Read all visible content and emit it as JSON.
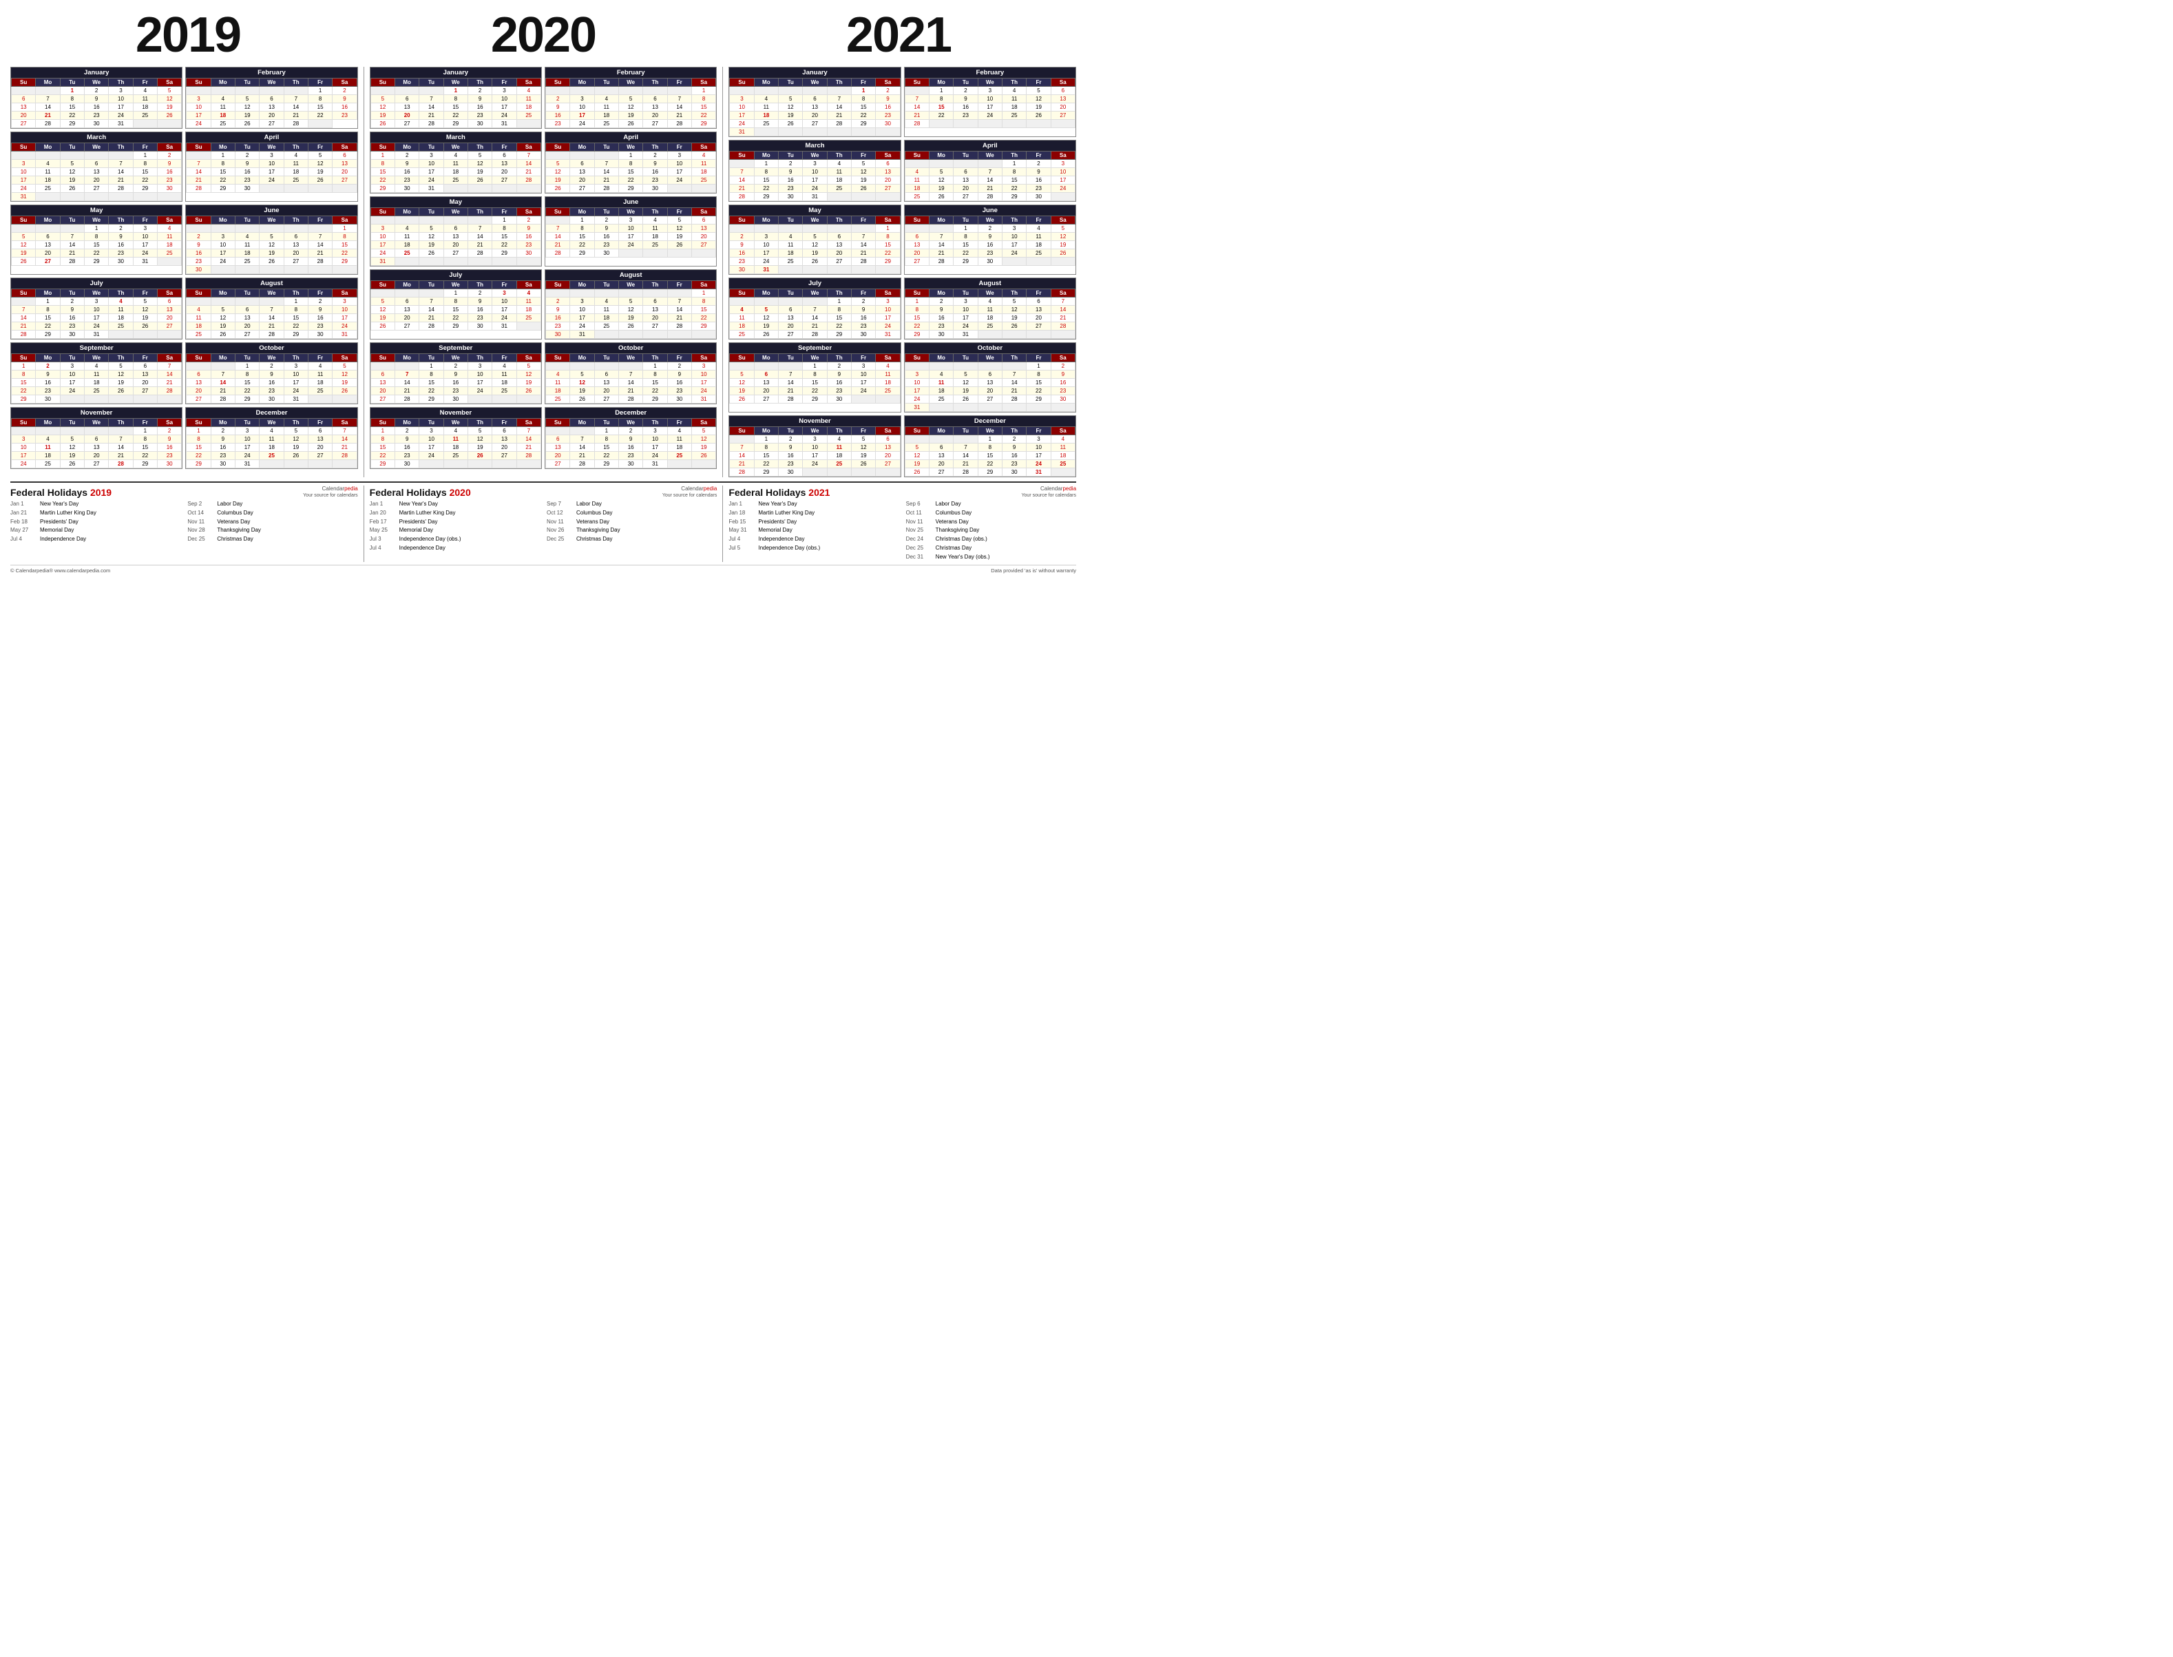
{
  "years": [
    "2019",
    "2020",
    "2021"
  ],
  "months2019": [
    {
      "name": "January",
      "startDay": 2,
      "days": 31,
      "headers": [
        "Su",
        "Mo",
        "Tu",
        "We",
        "Th",
        "Fr",
        "Sa"
      ],
      "rows": [
        [
          "",
          "",
          "1",
          "2",
          "3",
          "4",
          "5"
        ],
        [
          "6",
          "7",
          "8",
          "9",
          "10",
          "11",
          "12"
        ],
        [
          "13",
          "14",
          "15",
          "16",
          "17",
          "18",
          "19"
        ],
        [
          "20",
          "21",
          "22",
          "23",
          "24",
          "25",
          "26"
        ],
        [
          "27",
          "28",
          "29",
          "30",
          "31",
          "",
          ""
        ]
      ],
      "holidays": [
        1,
        21
      ]
    },
    {
      "name": "February",
      "startDay": 5,
      "days": 28,
      "rows": [
        [
          "",
          "",
          "",
          "",
          "",
          "1",
          "2"
        ],
        [
          "3",
          "4",
          "5",
          "6",
          "7",
          "8",
          "9"
        ],
        [
          "10",
          "11",
          "12",
          "13",
          "14",
          "15",
          "16"
        ],
        [
          "17",
          "18",
          "19",
          "20",
          "21",
          "22",
          "23"
        ],
        [
          "24",
          "25",
          "26",
          "27",
          "28",
          "",
          ""
        ]
      ],
      "holidays": [
        18
      ]
    },
    {
      "name": "March",
      "startDay": 5,
      "days": 31,
      "rows": [
        [
          "",
          "",
          "",
          "",
          "",
          "1",
          "2"
        ],
        [
          "3",
          "4",
          "5",
          "6",
          "7",
          "8",
          "9"
        ],
        [
          "10",
          "11",
          "12",
          "13",
          "14",
          "15",
          "16"
        ],
        [
          "17",
          "18",
          "19",
          "20",
          "21",
          "22",
          "23"
        ],
        [
          "24",
          "25",
          "26",
          "27",
          "28",
          "29",
          "30"
        ],
        [
          "31",
          "",
          "",
          "",
          "",
          "",
          ""
        ]
      ]
    },
    {
      "name": "April",
      "startDay": 1,
      "days": 30,
      "rows": [
        [
          "",
          "1",
          "2",
          "3",
          "4",
          "5",
          "6"
        ],
        [
          "7",
          "8",
          "9",
          "10",
          "11",
          "12",
          "13"
        ],
        [
          "14",
          "15",
          "16",
          "17",
          "18",
          "19",
          "20"
        ],
        [
          "21",
          "22",
          "23",
          "24",
          "25",
          "26",
          "27"
        ],
        [
          "28",
          "29",
          "30",
          "",
          "",
          "",
          ""
        ]
      ]
    },
    {
      "name": "May",
      "startDay": 3,
      "days": 31,
      "rows": [
        [
          "",
          "",
          "",
          "1",
          "2",
          "3",
          "4"
        ],
        [
          "5",
          "6",
          "7",
          "8",
          "9",
          "10",
          "11"
        ],
        [
          "12",
          "13",
          "14",
          "15",
          "16",
          "17",
          "18"
        ],
        [
          "19",
          "20",
          "21",
          "22",
          "23",
          "24",
          "25"
        ],
        [
          "26",
          "27",
          "28",
          "29",
          "30",
          "31",
          ""
        ]
      ],
      "holidays": [
        27
      ]
    },
    {
      "name": "June",
      "startDay": 6,
      "days": 30,
      "rows": [
        [
          "",
          "",
          "",
          "",
          "",
          "",
          "1"
        ],
        [
          "2",
          "3",
          "4",
          "5",
          "6",
          "7",
          "8"
        ],
        [
          "9",
          "10",
          "11",
          "12",
          "13",
          "14",
          "15"
        ],
        [
          "16",
          "17",
          "18",
          "19",
          "20",
          "21",
          "22"
        ],
        [
          "23",
          "24",
          "25",
          "26",
          "27",
          "28",
          "29"
        ],
        [
          "30",
          "",
          "",
          "",
          "",
          "",
          ""
        ]
      ]
    },
    {
      "name": "July",
      "startDay": 1,
      "days": 31,
      "rows": [
        [
          "",
          "1",
          "2",
          "3",
          "4",
          "5",
          "6"
        ],
        [
          "7",
          "8",
          "9",
          "10",
          "11",
          "12",
          "13"
        ],
        [
          "14",
          "15",
          "16",
          "17",
          "18",
          "19",
          "20"
        ],
        [
          "21",
          "22",
          "23",
          "24",
          "25",
          "26",
          "27"
        ],
        [
          "28",
          "29",
          "30",
          "31",
          "",
          "",
          ""
        ]
      ],
      "holidays": [
        4
      ]
    },
    {
      "name": "August",
      "startDay": 4,
      "days": 31,
      "rows": [
        [
          "",
          "",
          "",
          "",
          "1",
          "2",
          "3"
        ],
        [
          "4",
          "5",
          "6",
          "7",
          "8",
          "9",
          "10"
        ],
        [
          "11",
          "12",
          "13",
          "14",
          "15",
          "16",
          "17"
        ],
        [
          "18",
          "19",
          "20",
          "21",
          "22",
          "23",
          "24"
        ],
        [
          "25",
          "26",
          "27",
          "28",
          "29",
          "30",
          "31"
        ]
      ]
    },
    {
      "name": "September",
      "startDay": 0,
      "days": 30,
      "rows": [
        [
          "1",
          "2",
          "3",
          "4",
          "5",
          "6",
          "7"
        ],
        [
          "8",
          "9",
          "10",
          "11",
          "12",
          "13",
          "14"
        ],
        [
          "15",
          "16",
          "17",
          "18",
          "19",
          "20",
          "21"
        ],
        [
          "22",
          "23",
          "24",
          "25",
          "26",
          "27",
          "28"
        ],
        [
          "29",
          "30",
          "",
          "",
          "",
          "",
          ""
        ]
      ],
      "holidays": [
        2
      ]
    },
    {
      "name": "October",
      "startDay": 2,
      "days": 31,
      "rows": [
        [
          "",
          "",
          "1",
          "2",
          "3",
          "4",
          "5"
        ],
        [
          "6",
          "7",
          "8",
          "9",
          "10",
          "11",
          "12"
        ],
        [
          "13",
          "14",
          "15",
          "16",
          "17",
          "18",
          "19"
        ],
        [
          "20",
          "21",
          "22",
          "23",
          "24",
          "25",
          "26"
        ],
        [
          "27",
          "28",
          "29",
          "30",
          "31",
          "",
          ""
        ]
      ],
      "holidays": [
        14
      ]
    },
    {
      "name": "November",
      "startDay": 5,
      "days": 30,
      "rows": [
        [
          "",
          "",
          "",
          "",
          "",
          "1",
          "2"
        ],
        [
          "3",
          "4",
          "5",
          "6",
          "7",
          "8",
          "9"
        ],
        [
          "10",
          "11",
          "12",
          "13",
          "14",
          "15",
          "16"
        ],
        [
          "17",
          "18",
          "19",
          "20",
          "21",
          "22",
          "23"
        ],
        [
          "24",
          "25",
          "26",
          "27",
          "28",
          "29",
          "30"
        ]
      ],
      "holidays": [
        11,
        28
      ]
    },
    {
      "name": "December",
      "startDay": 0,
      "days": 31,
      "rows": [
        [
          "1",
          "2",
          "3",
          "4",
          "5",
          "6",
          "7"
        ],
        [
          "8",
          "9",
          "10",
          "11",
          "12",
          "13",
          "14"
        ],
        [
          "15",
          "16",
          "17",
          "18",
          "19",
          "20",
          "21"
        ],
        [
          "22",
          "23",
          "24",
          "25",
          "26",
          "27",
          "28"
        ],
        [
          "29",
          "30",
          "31",
          "",
          "",
          "",
          ""
        ]
      ],
      "holidays": [
        25
      ]
    }
  ],
  "federalHolidays": {
    "2019": {
      "left": [
        {
          "date": "Jan 1",
          "name": "New Year's Day"
        },
        {
          "date": "Jan 21",
          "name": "Martin Luther King Day"
        },
        {
          "date": "Feb 18",
          "name": "Presidents' Day"
        },
        {
          "date": "May 27",
          "name": "Memorial Day"
        },
        {
          "date": "Jul 4",
          "name": "Independence Day"
        }
      ],
      "right": [
        {
          "date": "Sep 2",
          "name": "Labor Day"
        },
        {
          "date": "Oct 14",
          "name": "Columbus Day"
        },
        {
          "date": "Nov 11",
          "name": "Veterans Day"
        },
        {
          "date": "Nov 28",
          "name": "Thanksgiving Day"
        },
        {
          "date": "Dec 25",
          "name": "Christmas Day"
        }
      ]
    },
    "2020": {
      "left": [
        {
          "date": "Jan 1",
          "name": "New Year's Day"
        },
        {
          "date": "Jan 20",
          "name": "Martin Luther King Day"
        },
        {
          "date": "Feb 17",
          "name": "Presidents' Day"
        },
        {
          "date": "May 25",
          "name": "Memorial Day"
        },
        {
          "date": "Jul 3",
          "name": "Independence Day (obs.)"
        },
        {
          "date": "Jul 4",
          "name": "Independence Day"
        }
      ],
      "right": [
        {
          "date": "Sep 7",
          "name": "Labor Day"
        },
        {
          "date": "Oct 12",
          "name": "Columbus Day"
        },
        {
          "date": "Nov 11",
          "name": "Veterans Day"
        },
        {
          "date": "Nov 26",
          "name": "Thanksgiving Day"
        },
        {
          "date": "Dec 25",
          "name": "Christmas Day"
        }
      ]
    },
    "2021": {
      "left": [
        {
          "date": "Jan 1",
          "name": "New Year's Day"
        },
        {
          "date": "Jan 18",
          "name": "Martin Luther King Day"
        },
        {
          "date": "Feb 15",
          "name": "Presidents' Day"
        },
        {
          "date": "May 31",
          "name": "Memorial Day"
        },
        {
          "date": "Jul 4",
          "name": "Independence Day"
        },
        {
          "date": "Jul 5",
          "name": "Independence Day (obs.)"
        }
      ],
      "right": [
        {
          "date": "Sep 6",
          "name": "Labor Day"
        },
        {
          "date": "Oct 11",
          "name": "Columbus Day"
        },
        {
          "date": "Nov 11",
          "name": "Veterans Day"
        },
        {
          "date": "Nov 25",
          "name": "Thanksgiving Day"
        },
        {
          "date": "Dec 24",
          "name": "Christmas Day (obs.)"
        },
        {
          "date": "Dec 25",
          "name": "Christmas Day"
        },
        {
          "date": "Dec 31",
          "name": "New Year's Day (obs.)"
        }
      ]
    }
  },
  "footer": {
    "left": "© Calendarpedia®  www.calendarpedia.com",
    "right": "Data provided 'as is' without warranty"
  },
  "brandName": "Calendar",
  "brandAccent": "pedia"
}
